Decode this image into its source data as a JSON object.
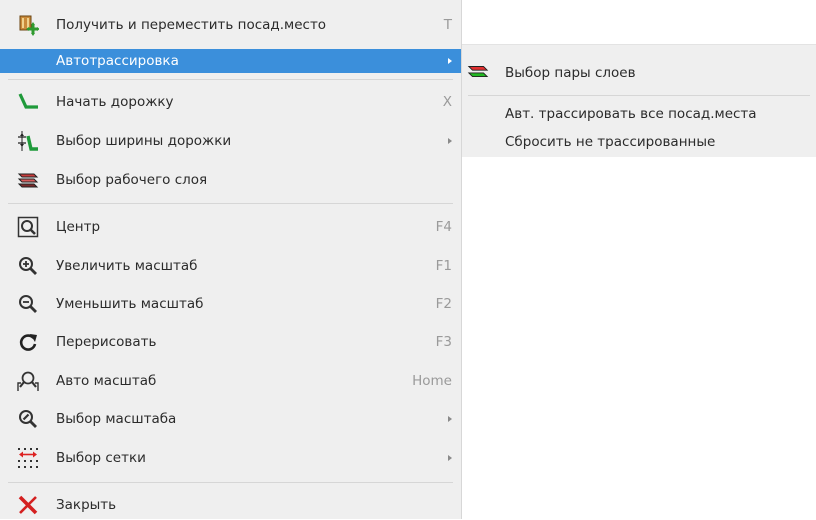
{
  "menu": {
    "items": [
      {
        "label": "Получить и переместить посад.место",
        "shortcut": "T",
        "icon": "footprint-move-icon"
      },
      {
        "label": "Автотрассировка",
        "shortcut": "",
        "icon": "",
        "submenu": true,
        "highlighted": true
      },
      {
        "label": "Начать дорожку",
        "shortcut": "X",
        "icon": "track-icon"
      },
      {
        "label": "Выбор ширины дорожки",
        "shortcut": "",
        "icon": "track-width-icon",
        "submenu": true
      },
      {
        "label": "Выбор рабочего слоя",
        "shortcut": "",
        "icon": "layers-icon"
      },
      {
        "label": "Центр",
        "shortcut": "F4",
        "icon": "zoom-center-icon"
      },
      {
        "label": "Увеличить масштаб",
        "shortcut": "F1",
        "icon": "zoom-in-icon"
      },
      {
        "label": "Уменьшить масштаб",
        "shortcut": "F2",
        "icon": "zoom-out-icon"
      },
      {
        "label": "Перерисовать",
        "shortcut": "F3",
        "icon": "redraw-icon"
      },
      {
        "label": "Авто масштаб",
        "shortcut": "Home",
        "icon": "zoom-fit-icon"
      },
      {
        "label": "Выбор масштаба",
        "shortcut": "",
        "icon": "zoom-select-icon",
        "submenu": true
      },
      {
        "label": "Выбор сетки",
        "shortcut": "",
        "icon": "grid-icon",
        "submenu": true
      },
      {
        "label": "Закрыть",
        "shortcut": "",
        "icon": "close-icon"
      }
    ]
  },
  "submenu": {
    "items": [
      {
        "label": "Выбор пары слоев",
        "icon": "layer-pair-icon"
      },
      {
        "label": "Авт. трассировать все посад.места",
        "icon": ""
      },
      {
        "label": "Сбросить не трассированные",
        "icon": ""
      }
    ]
  },
  "colors": {
    "highlight": "#3b8fdb",
    "menu_bg": "#efefef",
    "shortcut": "#9a9a9a"
  }
}
